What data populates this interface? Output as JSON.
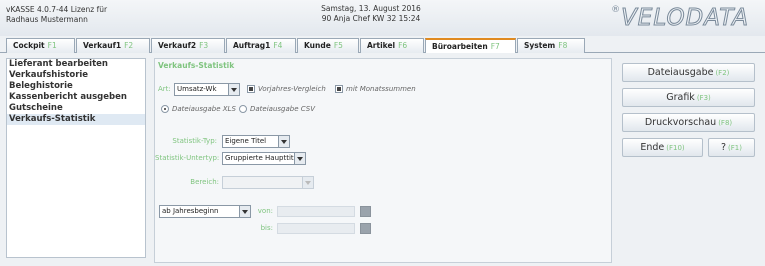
{
  "header": {
    "license_line1": "vKASSE 4.0.7-44 Lizenz für",
    "license_line2": "Radhaus Mustermann",
    "date_line": "Samstag, 13. August 2016",
    "user_line": "90 Anja Chef   KW 32  15:24",
    "logo": "VELODATA",
    "logo_mark": "®"
  },
  "tabs": [
    {
      "label": "Cockpit",
      "hotkey": "F1"
    },
    {
      "label": "Verkauf1",
      "hotkey": "F2"
    },
    {
      "label": "Verkauf2",
      "hotkey": "F3"
    },
    {
      "label": "Auftrag1",
      "hotkey": "F4"
    },
    {
      "label": "Kunde",
      "hotkey": "F5"
    },
    {
      "label": "Artikel",
      "hotkey": "F6"
    },
    {
      "label": "Büroarbeiten",
      "hotkey": "F7"
    },
    {
      "label": "System",
      "hotkey": "F8"
    }
  ],
  "sidebar": {
    "items": [
      {
        "label": "Lieferant bearbeiten"
      },
      {
        "label": "Verkaufshistorie"
      },
      {
        "label": "Beleghistorie"
      },
      {
        "label": "Kassenbericht ausgeben"
      },
      {
        "label": "Gutscheine"
      },
      {
        "label": "Verkaufs-Statistik"
      }
    ]
  },
  "main": {
    "title": "Verkaufs-Statistik",
    "art_label": "Art:",
    "art_value": "Umsatz-Wk",
    "vorjahres_label": "Vorjahres-Vergleich",
    "monats_label": "mit Monatssummen",
    "xls_label": "Dateiausgabe XLS",
    "csv_label": "Dateiausgabe CSV",
    "typ_label": "Statistik-Typ:",
    "typ_value": "Eigene Titel",
    "unterityp_label": "Statistik-Untertyp:",
    "unterityp_value": "Gruppierte Haupttitel",
    "bereich_label": "Bereich:",
    "bereich_value": "",
    "period_value": "ab Jahresbeginn",
    "von_label": "von:",
    "bis_label": "bis:"
  },
  "buttons": {
    "dateiausgabe": {
      "label": "Dateiausgabe",
      "hotkey": "(F2)"
    },
    "grafik": {
      "label": "Grafik",
      "hotkey": "(F3)"
    },
    "druckvorschau": {
      "label": "Druckvorschau",
      "hotkey": "(F8)"
    },
    "ende": {
      "label": "Ende",
      "hotkey": "(F10)"
    },
    "help": {
      "label": "?",
      "hotkey": "(F1)"
    }
  },
  "colors": {
    "accent_green": "#7fc47f",
    "active_tab_accent": "#e08a20"
  }
}
